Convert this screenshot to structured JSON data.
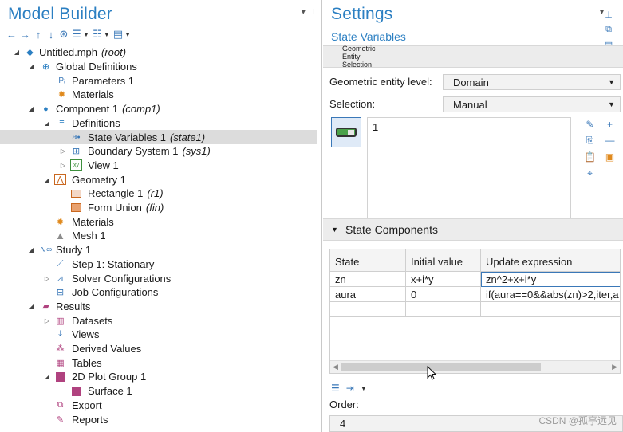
{
  "model_builder": {
    "title": "Model Builder",
    "tree": [
      {
        "label": "Untitled.mph",
        "tag": "(root)",
        "icon": "file-icon",
        "expanded": true
      },
      {
        "label": "Global Definitions",
        "icon": "globe-icon",
        "expanded": true
      },
      {
        "label": "Parameters 1",
        "icon": "parameters-icon"
      },
      {
        "label": "Materials",
        "icon": "materials-icon"
      },
      {
        "label": "Component 1",
        "tag": "(comp1)",
        "icon": "component-icon",
        "expanded": true
      },
      {
        "label": "Definitions",
        "icon": "definitions-icon",
        "expanded": true
      },
      {
        "label": "State Variables 1",
        "tag": "(state1)",
        "icon": "state-variables-icon",
        "selected": true
      },
      {
        "label": "Boundary System 1",
        "tag": "(sys1)",
        "icon": "boundary-system-icon",
        "expanded": false
      },
      {
        "label": "View 1",
        "icon": "view-icon",
        "expanded": false
      },
      {
        "label": "Geometry 1",
        "icon": "geometry-icon",
        "expanded": true
      },
      {
        "label": "Rectangle 1",
        "tag": "(r1)",
        "icon": "rectangle-icon"
      },
      {
        "label": "Form Union",
        "tag": "(fin)",
        "icon": "form-union-icon"
      },
      {
        "label": "Materials",
        "icon": "materials-icon"
      },
      {
        "label": "Mesh 1",
        "icon": "mesh-icon"
      },
      {
        "label": "Study 1",
        "icon": "study-icon",
        "expanded": true
      },
      {
        "label": "Step 1: Stationary",
        "icon": "stationary-step-icon"
      },
      {
        "label": "Solver Configurations",
        "icon": "solver-config-icon",
        "expanded": false
      },
      {
        "label": "Job Configurations",
        "icon": "job-config-icon"
      },
      {
        "label": "Results",
        "icon": "results-icon",
        "expanded": true
      },
      {
        "label": "Datasets",
        "icon": "datasets-icon",
        "expanded": false
      },
      {
        "label": "Views",
        "icon": "views-icon"
      },
      {
        "label": "Derived Values",
        "icon": "derived-values-icon"
      },
      {
        "label": "Tables",
        "icon": "tables-icon"
      },
      {
        "label": "2D Plot Group 1",
        "icon": "plot-group-icon",
        "expanded": true
      },
      {
        "label": "Surface 1",
        "icon": "surface-icon"
      },
      {
        "label": "Export",
        "icon": "export-icon"
      },
      {
        "label": "Reports",
        "icon": "reports-icon"
      }
    ]
  },
  "settings": {
    "title": "Settings",
    "subtitle": "State Variables",
    "geometric_section": {
      "title": "Geometric Entity Selection",
      "entity_level_label": "Geometric entity level:",
      "entity_level_value": "Domain",
      "selection_label": "Selection:",
      "selection_value": "Manual",
      "selected_items": [
        "1"
      ]
    },
    "state_components": {
      "title": "State Components",
      "columns": [
        "State",
        "Initial value",
        "Update expression"
      ],
      "rows": [
        [
          "zn",
          "x+i*y",
          "zn^2+x+i*y"
        ],
        [
          "aura",
          "0",
          "if(aura==0&&abs(zn)>2,iter,a"
        ],
        [
          "",
          "",
          ""
        ]
      ]
    },
    "order_label": "Order:",
    "order_value": "4"
  },
  "watermark": "CSDN @孤亭远见"
}
